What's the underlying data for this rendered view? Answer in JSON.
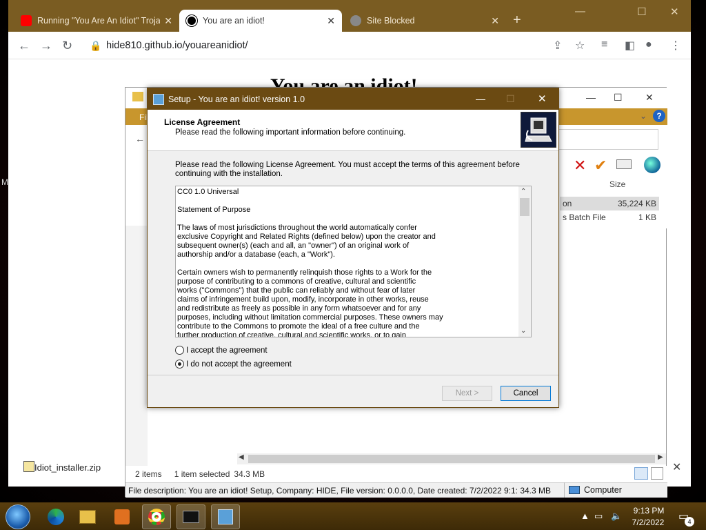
{
  "desktop": {
    "left_text": "M"
  },
  "chrome": {
    "tabs": [
      {
        "label": "Running \"You Are An Idiot\" Troja",
        "active": false
      },
      {
        "label": "You are an idiot!",
        "active": true
      },
      {
        "label": "Site Blocked",
        "active": false
      }
    ],
    "new_tab": "+",
    "url": "hide810.github.io/youareanidiot/",
    "page_heading": "You are an idiot!",
    "download": {
      "filename": "Idiot_installer.zip"
    }
  },
  "explorer": {
    "menu_label": "Fil",
    "size_header": "Size",
    "rows": [
      {
        "name": "on",
        "size": "35,224 KB"
      },
      {
        "name": "s Batch File",
        "size": "1 KB"
      }
    ],
    "status": {
      "items": "2 items",
      "selected": "1 item selected",
      "size": "34.3 MB"
    },
    "details": "File description: You are an idiot! Setup, Company: HIDE, File version: 0.0.0.0, Date created: 7/2/2022 9:1: 34.3 MB",
    "computer_label": "Computer"
  },
  "setup": {
    "title": "Setup - You are an idiot! version 1.0",
    "heading": "License Agreement",
    "subheading": "Please read the following important information before continuing.",
    "intro": "Please read the following License Agreement. You must accept the terms of this agreement before continuing with the installation.",
    "license_text": "CC0 1.0 Universal\n\nStatement of Purpose\n\nThe laws of most jurisdictions throughout the world automatically confer\nexclusive Copyright and Related Rights (defined below) upon the creator and\nsubsequent owner(s) (each and all, an \"owner\") of an original work of\nauthorship and/or a database (each, a \"Work\").\n\nCertain owners wish to permanently relinquish those rights to a Work for the\npurpose of contributing to a commons of creative, cultural and scientific\nworks (\"Commons\") that the public can reliably and without fear of later\nclaims of infringement build upon, modify, incorporate in other works, reuse\nand redistribute as freely as possible in any form whatsoever and for any\npurposes, including without limitation commercial purposes. These owners may\ncontribute to the Commons to promote the ideal of a free culture and the\nfurther production of creative, cultural and scientific works, or to gain",
    "radio_accept": "I accept the agreement",
    "radio_decline": "I do not accept the agreement",
    "selected_option": "decline",
    "next_label": "Next >",
    "cancel_label": "Cancel"
  },
  "taskbar": {
    "time": "9:13 PM",
    "date": "7/2/2022",
    "notifications": "4"
  }
}
